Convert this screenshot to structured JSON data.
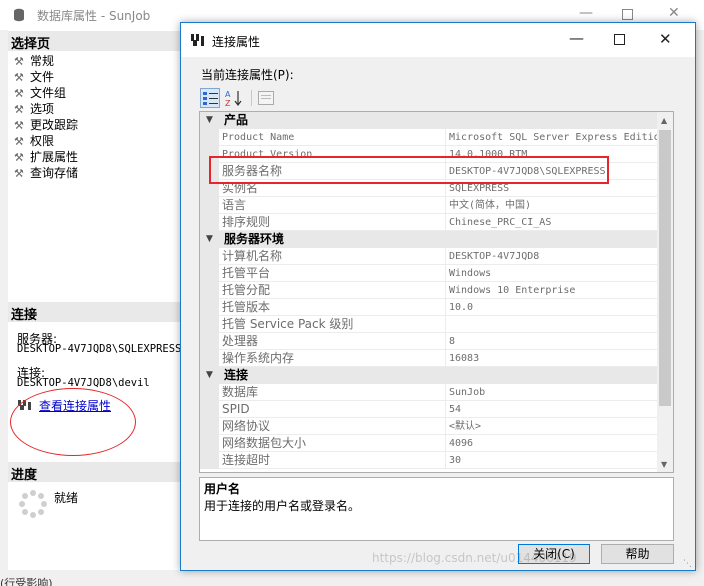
{
  "background_window": {
    "title": "数据库属性 - SunJob",
    "select_page_header": "选择页",
    "pages": [
      "常规",
      "文件",
      "文件组",
      "选项",
      "更改跟踪",
      "权限",
      "扩展属性",
      "查询存储"
    ],
    "connection_header": "连接",
    "server_label": "服务器:",
    "server_value": "DESKTOP-4V7JQD8\\SQLEXPRESS",
    "connection_label": "连接:",
    "connection_value": "DESKTOP-4V7JQD8\\devil",
    "view_connection_link": "查看连接属性",
    "progress_header": "进度",
    "progress_status": "就绪",
    "bottom_fragment": "(行受影响)"
  },
  "dialog": {
    "title": "连接属性",
    "current_props_label": "当前连接属性(P):",
    "categories": [
      {
        "name": "产品",
        "rows": [
          {
            "name": "Product Name",
            "value": "Microsoft SQL Server Express Edition (",
            "mono": true
          },
          {
            "name": "Product Version",
            "value": "14.0.1000 RTM",
            "mono": true
          },
          {
            "name": "服务器名称",
            "value": "DESKTOP-4V7JQD8\\SQLEXPRESS"
          },
          {
            "name": "实例名",
            "value": "SQLEXPRESS"
          },
          {
            "name": "语言",
            "value": "中文(简体，中国)"
          },
          {
            "name": "排序规则",
            "value": "Chinese_PRC_CI_AS"
          }
        ]
      },
      {
        "name": "服务器环境",
        "rows": [
          {
            "name": "计算机名称",
            "value": "DESKTOP-4V7JQD8"
          },
          {
            "name": "托管平台",
            "value": "Windows"
          },
          {
            "name": "托管分配",
            "value": "Windows 10 Enterprise"
          },
          {
            "name": "托管版本",
            "value": "10.0"
          },
          {
            "name": "托管 Service Pack 级别",
            "value": ""
          },
          {
            "name": "处理器",
            "value": "8"
          },
          {
            "name": "操作系统内存",
            "value": "16083"
          }
        ]
      },
      {
        "name": "连接",
        "rows": [
          {
            "name": "数据库",
            "value": "SunJob"
          },
          {
            "name": "SPID",
            "value": "54"
          },
          {
            "name": "网络协议",
            "value": "<默认>"
          },
          {
            "name": "网络数据包大小",
            "value": "4096"
          },
          {
            "name": "连接超时",
            "value": "30"
          }
        ]
      }
    ],
    "help_title": "用户名",
    "help_text": "用于连接的用户名或登录名。",
    "close_button": "关闭(C)",
    "help_button": "帮助"
  },
  "watermark": "https://blog.csdn.net/u014406119"
}
